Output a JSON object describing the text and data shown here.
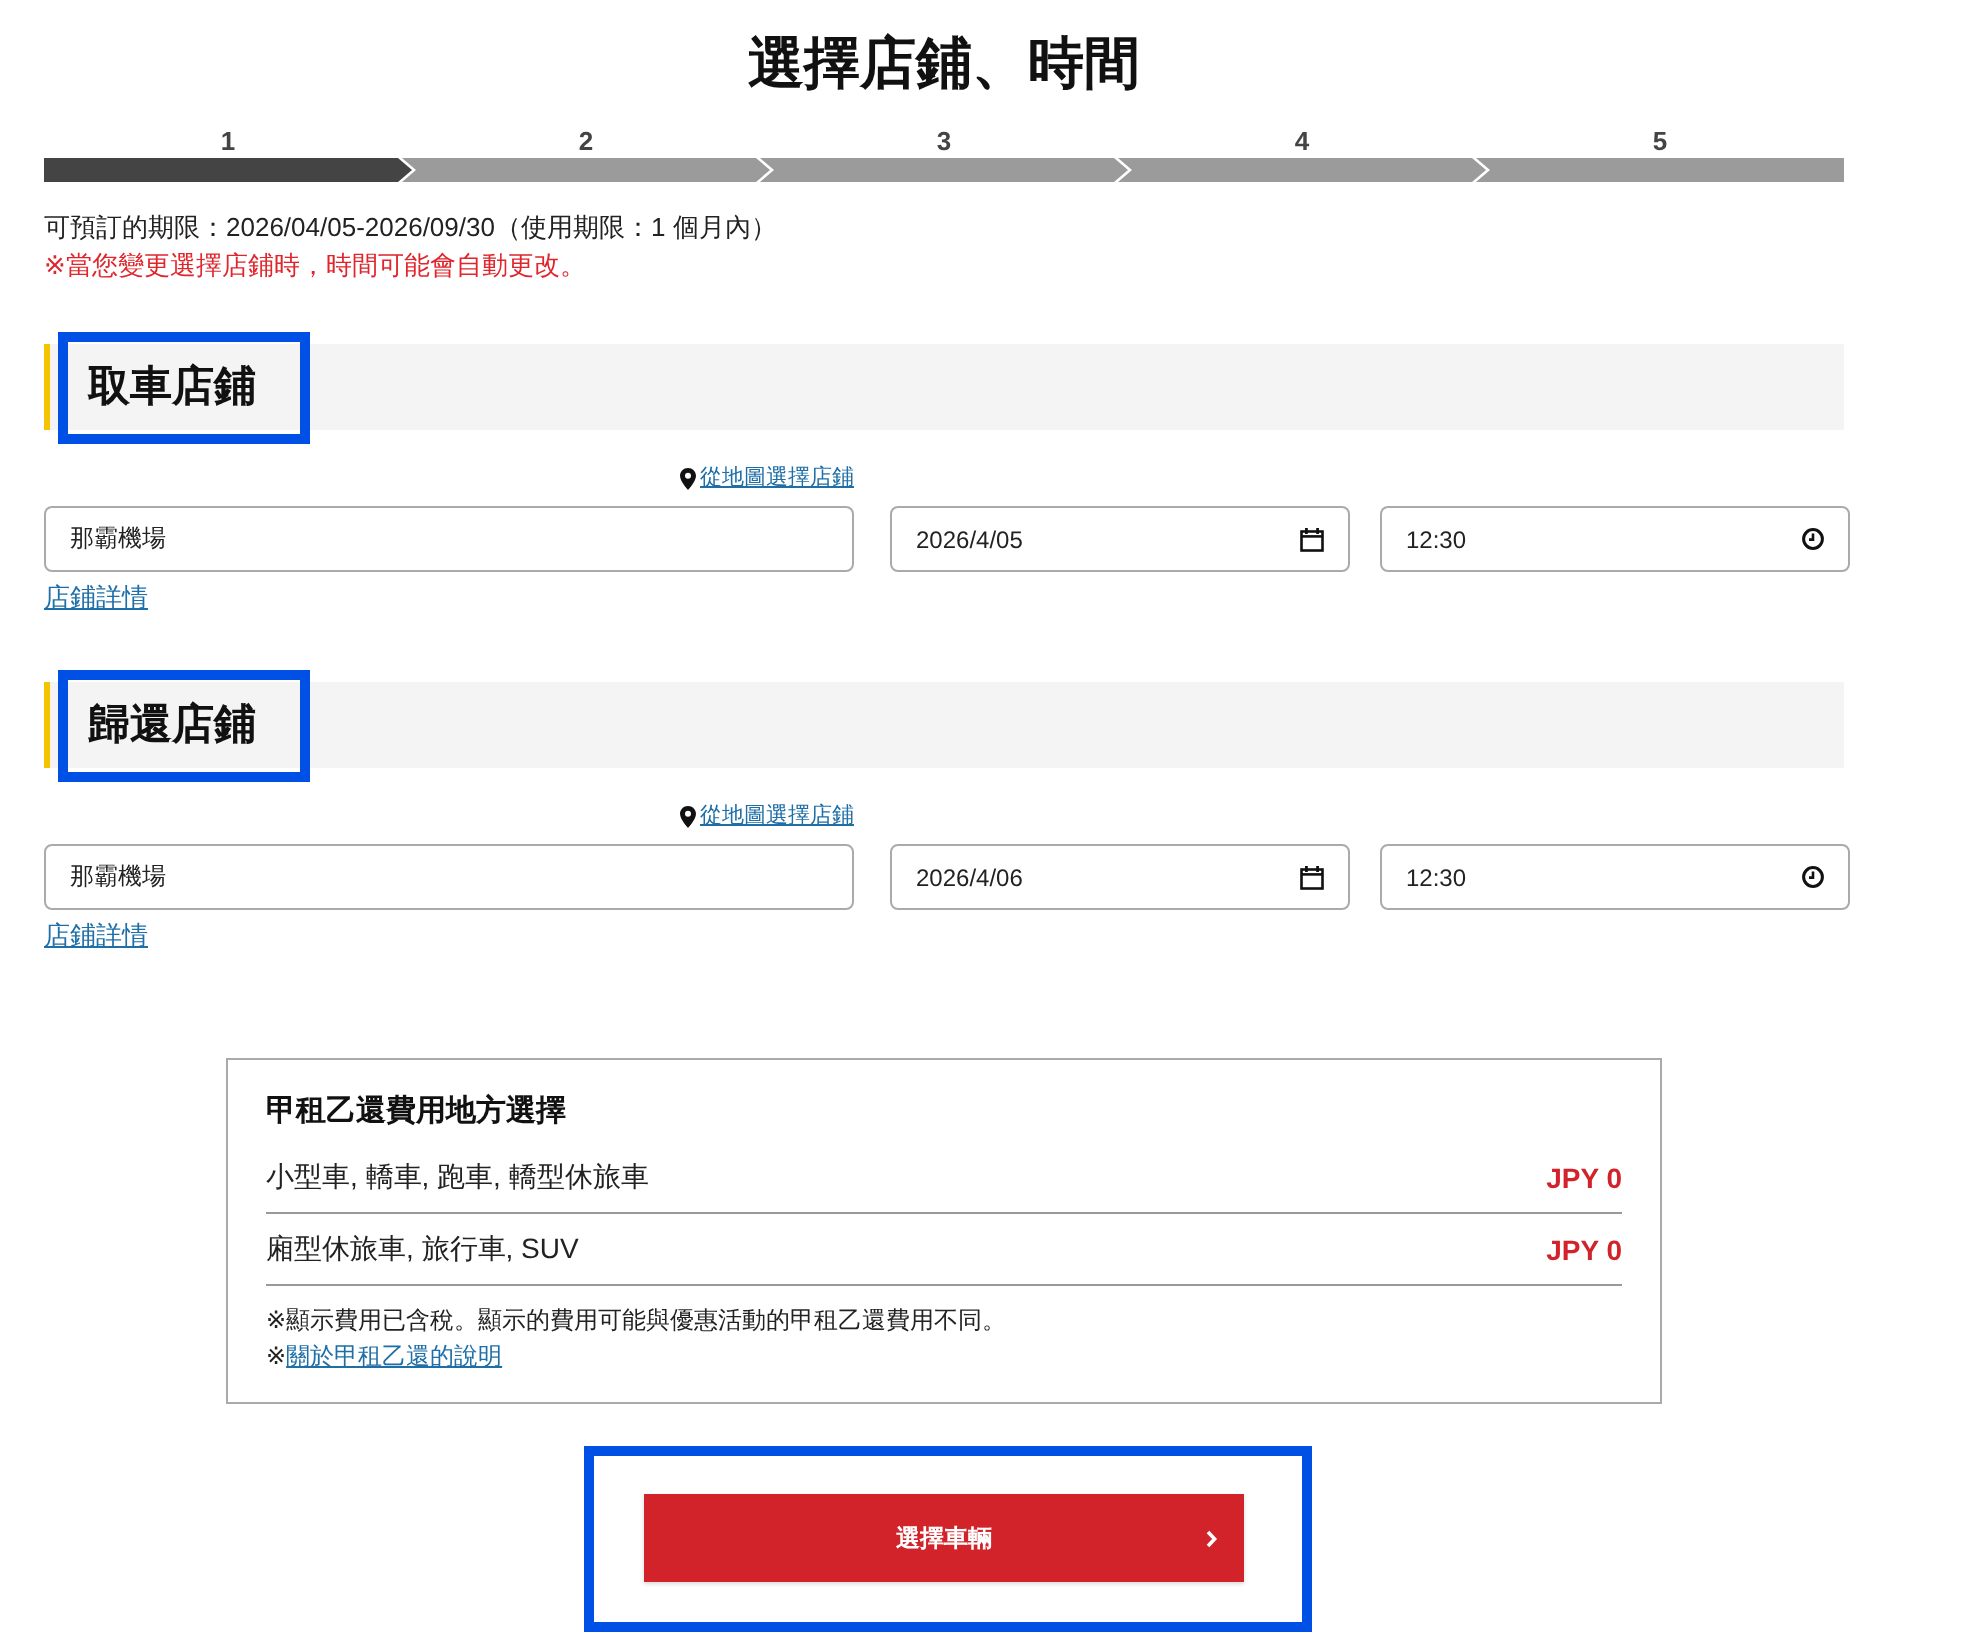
{
  "page_title": "選擇店鋪、時間",
  "steps": [
    {
      "label": "1",
      "selected": true
    },
    {
      "label": "2",
      "selected": false
    },
    {
      "label": "3",
      "selected": false
    },
    {
      "label": "4",
      "selected": false
    },
    {
      "label": "5",
      "selected": false
    }
  ],
  "booking_period": "可預訂的期限：2026/04/05-2026/09/30（使用期限：1 個月內）",
  "notice": "※當您變更選擇店鋪時，時間可能會自動更改。",
  "sections": [
    {
      "title": "取車店鋪",
      "highlighted": true,
      "map_link": "從地圖選擇店鋪",
      "store": {
        "value": "那霸機場"
      },
      "date": {
        "value": "2026/4/05"
      },
      "time": {
        "value": "12:30"
      },
      "details_link": "店鋪詳情"
    },
    {
      "title": "歸還店鋪",
      "highlighted": true,
      "map_link": "從地圖選擇店鋪",
      "store": {
        "value": "那霸機場"
      },
      "date": {
        "value": "2026/4/06"
      },
      "time": {
        "value": "12:30"
      },
      "details_link": "店鋪詳情"
    }
  ],
  "fee_box": {
    "title": "甲租乙還費用地方選擇",
    "rows": [
      {
        "label": "小型車, 轎車, 跑車, 轎型休旅車",
        "price": "JPY 0"
      },
      {
        "label": "廂型休旅車, 旅行車, SUV",
        "price": "JPY 0"
      }
    ],
    "note": "※顯示費用已含稅。顯示的費用可能與優惠活動的甲租乙還費用不同。",
    "link_prefix": "※",
    "link": "關於甲租乙還的說明"
  },
  "next_button": {
    "label": "選擇車輛",
    "highlighted": true
  }
}
